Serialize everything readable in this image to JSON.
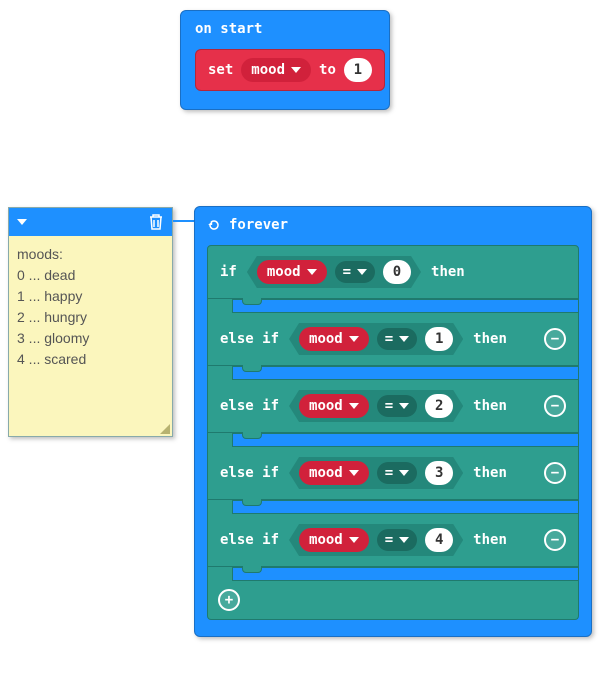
{
  "on_start": {
    "title": "on start",
    "set_label": "set",
    "var_name": "mood",
    "to_label": "to",
    "value": "1"
  },
  "comment": {
    "title": "moods:",
    "lines": [
      "0 ... dead",
      "1 ... happy",
      "2 ... hungry",
      "3 ... gloomy",
      "4 ... scared"
    ]
  },
  "forever": {
    "title": "forever",
    "branches": [
      {
        "kw": "if",
        "var": "mood",
        "op": "=",
        "val": "0",
        "then": "then",
        "minus": false
      },
      {
        "kw": "else if",
        "var": "mood",
        "op": "=",
        "val": "1",
        "then": "then",
        "minus": true
      },
      {
        "kw": "else if",
        "var": "mood",
        "op": "=",
        "val": "2",
        "then": "then",
        "minus": true
      },
      {
        "kw": "else if",
        "var": "mood",
        "op": "=",
        "val": "3",
        "then": "then",
        "minus": true
      },
      {
        "kw": "else if",
        "var": "mood",
        "op": "=",
        "val": "4",
        "then": "then",
        "minus": true
      }
    ]
  },
  "colors": {
    "hat": "#1e90ff",
    "set": "#e6304a",
    "teal": "#2e9e8f",
    "note": "#fbf6bd"
  }
}
